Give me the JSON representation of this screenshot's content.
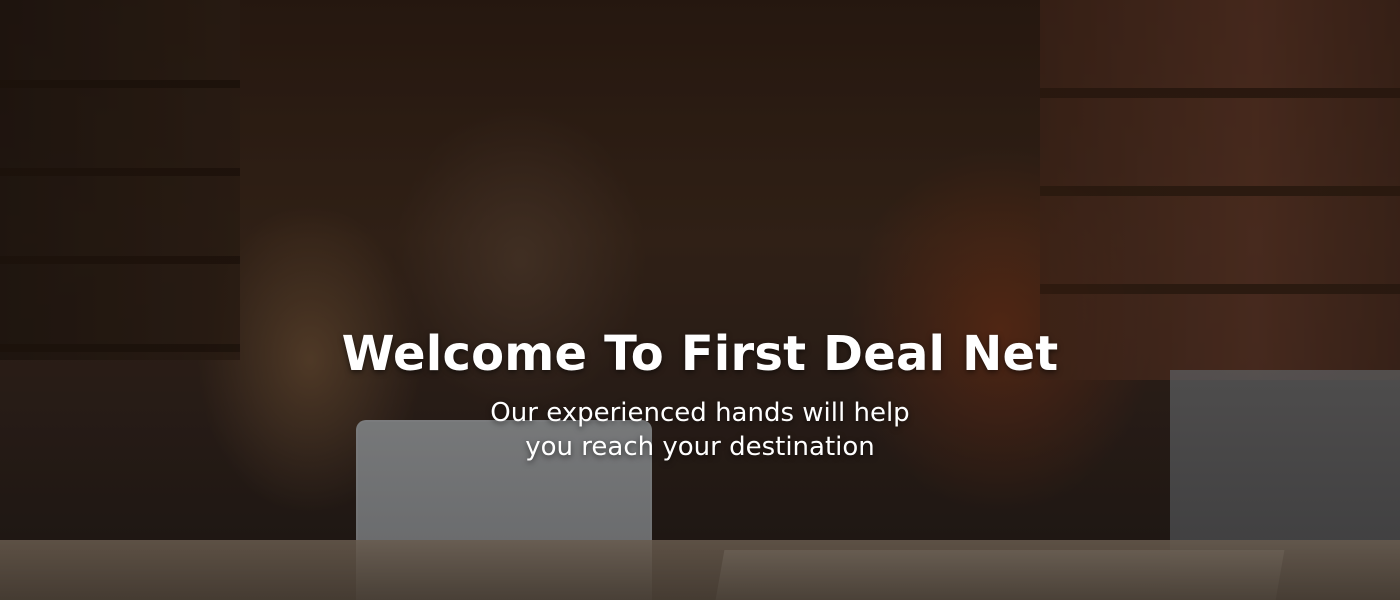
{
  "hero": {
    "title": "Welcome To First Deal Net",
    "subtitle_line1": "Our experienced hands will help",
    "subtitle_line2": "you reach your destination"
  },
  "colors": {
    "text": "#ffffff",
    "overlay": "rgba(0,0,0,0.35)"
  }
}
